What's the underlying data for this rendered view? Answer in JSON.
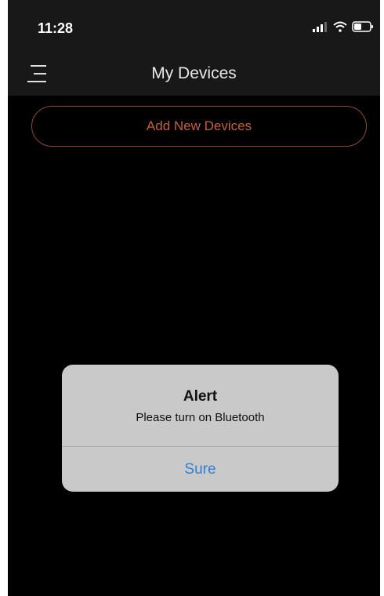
{
  "status_bar": {
    "time": "11:28"
  },
  "nav": {
    "title": "My Devices",
    "menu_icon": "menu-icon"
  },
  "actions": {
    "add_label": "Add New Devices"
  },
  "alert": {
    "title": "Alert",
    "message": "Please turn on Bluetooth",
    "button_label": "Sure"
  },
  "colors": {
    "background": "#000000",
    "bar": "#181818",
    "accent": "#c2603f",
    "alert_bg": "#c9c9c9",
    "alert_action": "#2f7fd6"
  }
}
